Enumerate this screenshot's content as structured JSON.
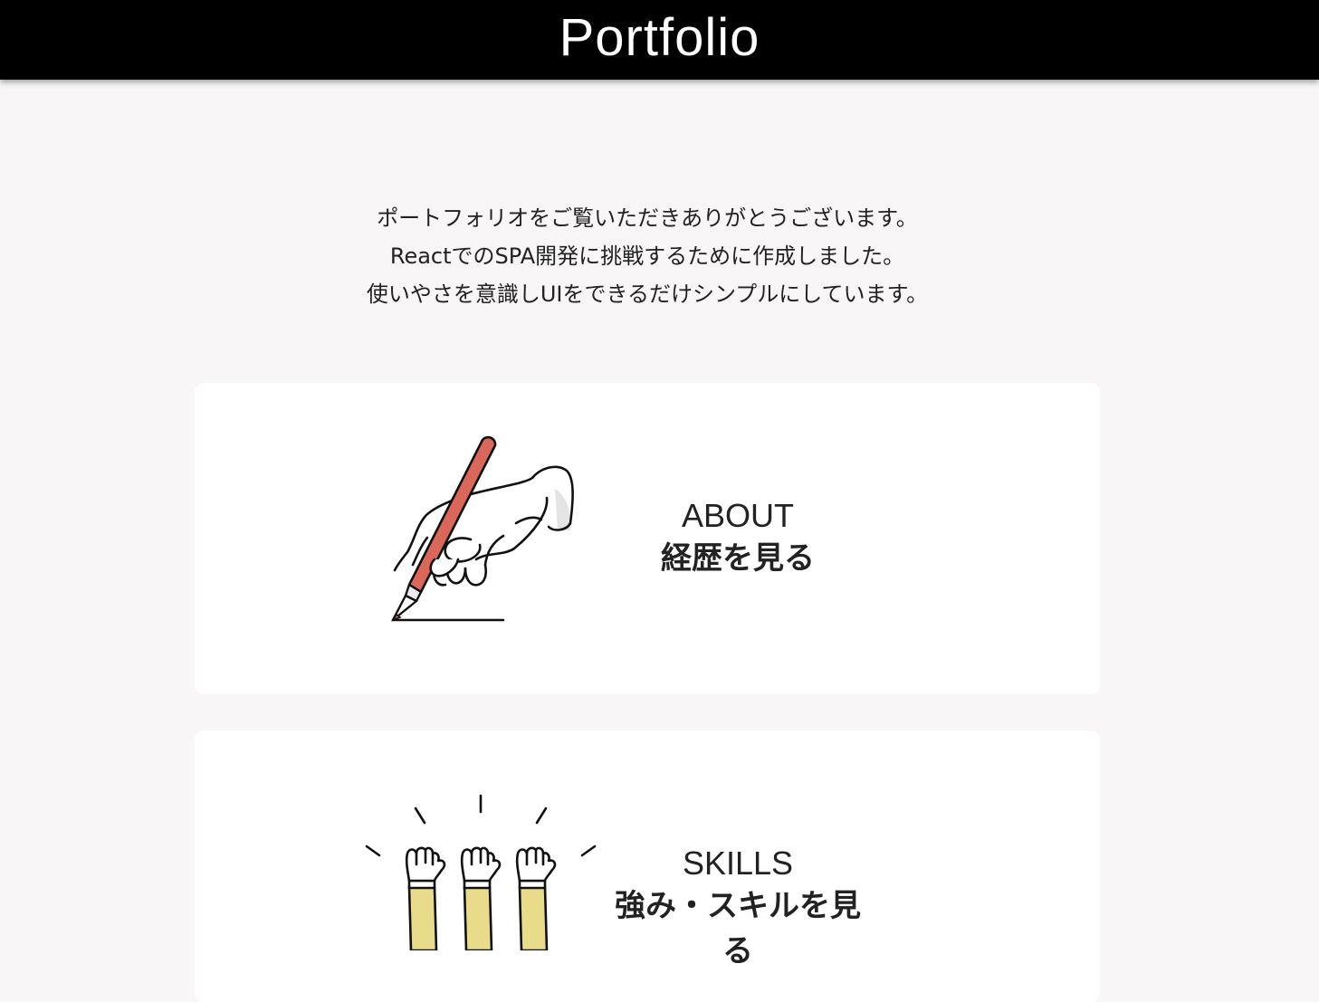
{
  "header": {
    "title": "Portfolio"
  },
  "intro": {
    "lines": [
      "ポートフォリオをご覧いただきありがとうございます。",
      "ReactでのSPA開発に挑戦するために作成しました。",
      "使いやさを意識しUIをできるだけシンプルにしています。"
    ]
  },
  "cards": [
    {
      "title_en": "ABOUT",
      "title_ja": "経歴を見る",
      "icon": "writing-hand-icon",
      "accent": "#d9675a"
    },
    {
      "title_en": "SKILLS",
      "title_ja": "強み・スキルを見る",
      "icon": "raised-hands-icon",
      "accent": "#e8db8a"
    }
  ]
}
